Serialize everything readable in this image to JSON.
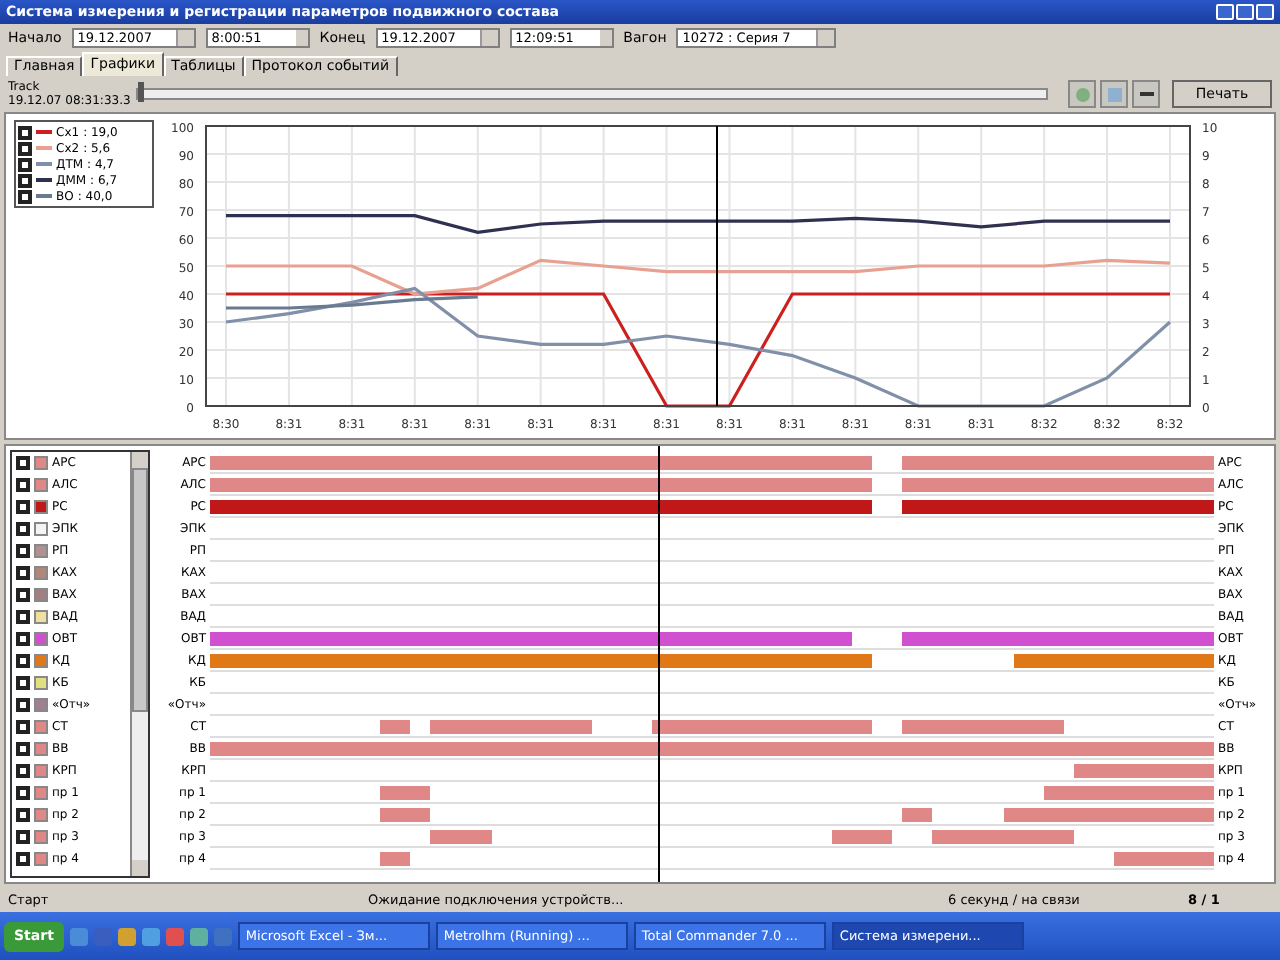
{
  "window": {
    "title": "Система измерения и регистрации параметров подвижного состава"
  },
  "toolbar": {
    "start_label": "Начало",
    "start_date": "19.12.2007",
    "start_time": "8:00:51",
    "end_label": "Конец",
    "end_date": "19.12.2007",
    "end_time": "12:09:51",
    "car_label": "Вагон",
    "car": "10272 : Серия 7"
  },
  "tabs": [
    {
      "label": "Главная",
      "selected": false
    },
    {
      "label": "Графики",
      "selected": true
    },
    {
      "label": "Таблицы",
      "selected": false
    },
    {
      "label": "Протокол событий",
      "selected": false
    }
  ],
  "track": {
    "label": "Track",
    "time": "19.12.07 08:31:33.3",
    "level": 0.0,
    "print_button": "Печать"
  },
  "legend": [
    {
      "value": ": 19,0",
      "checked": true
    },
    {
      "value": ": 5,6",
      "checked": true
    },
    {
      "value": ": 4,7",
      "checked": true
    },
    {
      "value": ": 6,7",
      "checked": true
    },
    {
      "value": ": 40,0",
      "checked": true
    }
  ],
  "chart": {
    "right_axis_ticks": [
      "10",
      "9",
      "8",
      "7",
      "6",
      "5",
      "4",
      "3",
      "2",
      "1",
      "0"
    ],
    "chart_data": {
      "type": "line",
      "grid": true,
      "categories": [
        "8:30",
        "8:31",
        "8:31",
        "8:31",
        "8:31",
        "8:31",
        "8:31",
        "8:31",
        "8:31",
        "8:31",
        "8:31",
        "8:31",
        "8:31",
        "8:32",
        "8:32",
        "8:32"
      ],
      "ylim": [
        0,
        100
      ],
      "yticks": [
        0,
        10,
        20,
        30,
        40,
        50,
        60,
        70,
        80,
        90,
        100
      ],
      "series": [
        {
          "name": "Сх1",
          "color": "#cc2020",
          "values": [
            40,
            40,
            40,
            40,
            40,
            40,
            40,
            0,
            0,
            40,
            40,
            40,
            40,
            40,
            40,
            40
          ]
        },
        {
          "name": "Сх2",
          "color": "#e8a090",
          "values": [
            50,
            50,
            50,
            40,
            42,
            52,
            50,
            48,
            48,
            48,
            48,
            50,
            50,
            50,
            52,
            51
          ]
        },
        {
          "name": "ДТМ",
          "color": "#8090a8",
          "values": [
            30,
            33,
            37,
            42,
            25,
            22,
            22,
            25,
            22,
            18,
            10,
            0,
            0,
            0,
            10,
            30
          ]
        },
        {
          "name": "ДММ",
          "color": "#303050",
          "values": [
            68,
            68,
            68,
            68,
            62,
            65,
            66,
            66,
            66,
            66,
            67,
            66,
            64,
            66,
            66,
            66
          ]
        },
        {
          "name": "ВО",
          "color": "#6a7a90",
          "values": [
            35,
            35,
            36,
            38,
            39,
            null,
            null,
            null,
            null,
            null,
            null,
            null,
            null,
            null,
            null,
            null
          ]
        }
      ]
    }
  },
  "channels": [
    {
      "label": "АРС",
      "color": "#e08888",
      "checked": true
    },
    {
      "label": "АЛС",
      "color": "#e08888",
      "checked": true
    },
    {
      "label": "РС",
      "color": "#c01818",
      "checked": true
    },
    {
      "label": "ЭПК",
      "color": "#f4f4f4",
      "checked": true
    },
    {
      "label": "РП",
      "color": "#b09090",
      "checked": true
    },
    {
      "label": "КАХ",
      "color": "#b08878",
      "checked": true
    },
    {
      "label": "ВАХ",
      "color": "#a08080",
      "checked": true
    },
    {
      "label": "ВАД",
      "color": "#f0e0a0",
      "checked": true
    },
    {
      "label": "ОВТ",
      "color": "#d050d0",
      "checked": true
    },
    {
      "label": "КД",
      "color": "#e07818",
      "checked": true
    },
    {
      "label": "КБ",
      "color": "#e0e080",
      "checked": true
    },
    {
      "label": "«Отч»",
      "color": "#a08090",
      "checked": true
    },
    {
      "label": "СТ",
      "color": "#e08888",
      "checked": true
    },
    {
      "label": "ВВ",
      "color": "#e08888",
      "checked": true
    },
    {
      "label": "КРП",
      "color": "#e08888",
      "checked": true
    },
    {
      "label": "пр 1",
      "color": "#e08888",
      "checked": true
    },
    {
      "label": "пр 2",
      "color": "#e08888",
      "checked": true
    },
    {
      "label": "пр 3",
      "color": "#e08888",
      "checked": true
    },
    {
      "label": "пр 4",
      "color": "#e08888",
      "checked": true
    }
  ],
  "lanes": [
    {
      "left": "АРС",
      "right": "АРС"
    },
    {
      "left": "АЛС",
      "right": "АЛС"
    },
    {
      "left": "РС",
      "right": "РС"
    },
    {
      "left": "ЭПК",
      "right": "ЭПК"
    },
    {
      "left": "РП",
      "right": "РП"
    },
    {
      "left": "КАХ",
      "right": "КАХ"
    },
    {
      "left": "ВАХ",
      "right": "ВАХ"
    },
    {
      "left": "ВАД",
      "right": "ВАД"
    },
    {
      "left": "ОВТ",
      "right": "ОВТ"
    },
    {
      "left": "КД",
      "right": "КД"
    },
    {
      "left": "КБ",
      "right": "КБ"
    },
    {
      "left": "«Отч»",
      "right": "«Отч»"
    },
    {
      "left": "СТ",
      "right": "СТ"
    },
    {
      "left": "ВВ",
      "right": "ВВ"
    },
    {
      "left": "КРП",
      "right": "КРП"
    },
    {
      "left": "пр 1",
      "right": "пр 1"
    },
    {
      "left": "пр 2",
      "right": "пр 2"
    },
    {
      "left": "пр 3",
      "right": "пр 3"
    },
    {
      "left": "пр 4",
      "right": "пр 4"
    }
  ],
  "status_bar": {
    "left": "Старт",
    "message": "Ожидание подключения устройств...",
    "connection": "6 секунд / на связи",
    "counter": "8 / 1"
  },
  "taskbar": {
    "start": "Start",
    "tasks": [
      {
        "label": "Microsoft Excel - Зм...",
        "selected": false
      },
      {
        "label": "Metrolhm (Running) ...",
        "selected": false
      },
      {
        "label": "Total Commander 7.0 ...",
        "selected": false
      },
      {
        "label": "Система измерени...",
        "selected": true
      }
    ]
  }
}
